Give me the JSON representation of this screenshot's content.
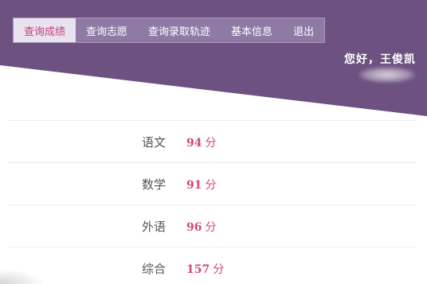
{
  "theme": {
    "header_color": "#6c5181",
    "nav_color": "#8f7aa6",
    "accent_color": "#d2457f"
  },
  "nav": {
    "items": [
      {
        "label": "查询成绩",
        "active": true
      },
      {
        "label": "查询志愿",
        "active": false
      },
      {
        "label": "查询录取轨迹",
        "active": false
      },
      {
        "label": "基本信息",
        "active": false
      },
      {
        "label": "退出",
        "active": false
      }
    ]
  },
  "user": {
    "greeting": "您好，王俊凯"
  },
  "scores": {
    "unit": "分",
    "rows": [
      {
        "subject": "语文",
        "score": "94"
      },
      {
        "subject": "数学",
        "score": "91"
      },
      {
        "subject": "外语",
        "score": "96"
      },
      {
        "subject": "综合",
        "score": "157"
      }
    ]
  }
}
